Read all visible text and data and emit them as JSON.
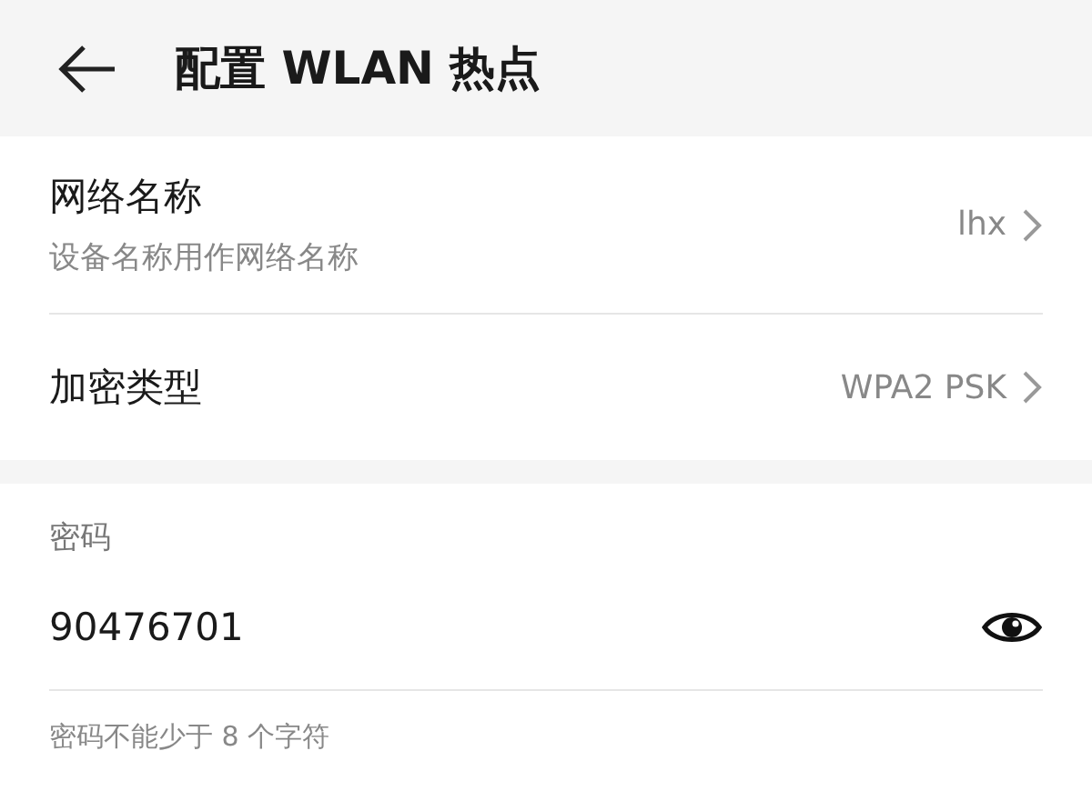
{
  "header": {
    "title": "配置 WLAN 热点"
  },
  "settings": [
    {
      "title": "网络名称",
      "subtitle": "设备名称用作网络名称",
      "value": "lhx"
    },
    {
      "title": "加密类型",
      "value": "WPA2 PSK"
    }
  ],
  "password": {
    "label": "密码",
    "value": "90476701",
    "hint": "密码不能少于 8 个字符"
  }
}
